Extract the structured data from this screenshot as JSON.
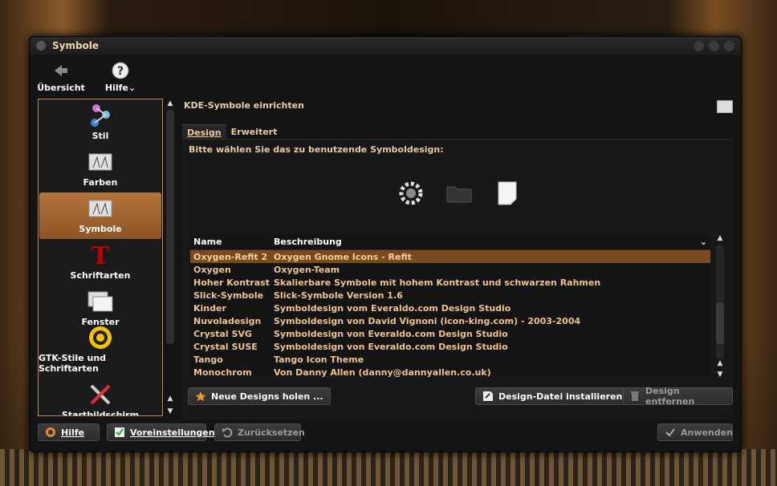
{
  "window": {
    "title": "Symbole"
  },
  "toolbar": {
    "overview_label": "Übersicht",
    "help_label": "Hilfe"
  },
  "sidebar": {
    "items": [
      {
        "label": "Stil",
        "icon": "style-icon"
      },
      {
        "label": "Farben",
        "icon": "colors-icon"
      },
      {
        "label": "Symbole",
        "icon": "icons-icon",
        "active": true
      },
      {
        "label": "Schriftarten",
        "icon": "fonts-icon"
      },
      {
        "label": "Fenster",
        "icon": "windows-icon"
      },
      {
        "label": "GTK-Stile und Schriftarten",
        "icon": "gtk-icon"
      },
      {
        "label": "Startbildschirm",
        "icon": "splash-icon"
      }
    ]
  },
  "content": {
    "title": "KDE-Symbole einrichten",
    "tabs": [
      "Design",
      "Erweitert"
    ],
    "prompt": "Bitte wählen Sie das zu benutzende Symboldesign:",
    "columns": [
      "Name",
      "Beschreibung"
    ],
    "rows": [
      {
        "name": "Oxygen-Refit 2 ...",
        "desc": "Oxygen Gnome Icons - Refit"
      },
      {
        "name": "Oxygen",
        "desc": "Oxygen-Team"
      },
      {
        "name": "Hoher Kontrast...",
        "desc": "Skalierbare Symbole mit hohem Kontrast und schwarzen Rahmen"
      },
      {
        "name": "Slick-Symbole",
        "desc": "Slick-Symbole Version 1.6"
      },
      {
        "name": "Kinder",
        "desc": "Symboldesign vom Everaldo.com Design Studio"
      },
      {
        "name": "Nuvoladesign",
        "desc": "Symboldesign von David Vignoni (icon-king.com) - 2003-2004"
      },
      {
        "name": "Crystal SVG",
        "desc": "Symboldesign von Everaldo.com Design Studio"
      },
      {
        "name": "Crystal SUSE",
        "desc": "Symboldesign von Everaldo.com Design Studio"
      },
      {
        "name": "Tango",
        "desc": "Tango Icon Theme"
      },
      {
        "name": "Monochrom",
        "desc": "Von Danny Allen (danny@dannyallen.co.uk)"
      }
    ],
    "buttons": {
      "get_new": "Neue Designs holen ...",
      "install": "Design-Datei installieren ...",
      "remove": "Design entfernen"
    }
  },
  "footer": {
    "help": "Hilfe",
    "defaults": "Voreinstellungen",
    "reset": "Zurücksetzen",
    "apply": "Anwenden"
  },
  "colors": {
    "accent": "#a8662e",
    "selection": "#7a4a1c",
    "text": "#efc48a"
  }
}
